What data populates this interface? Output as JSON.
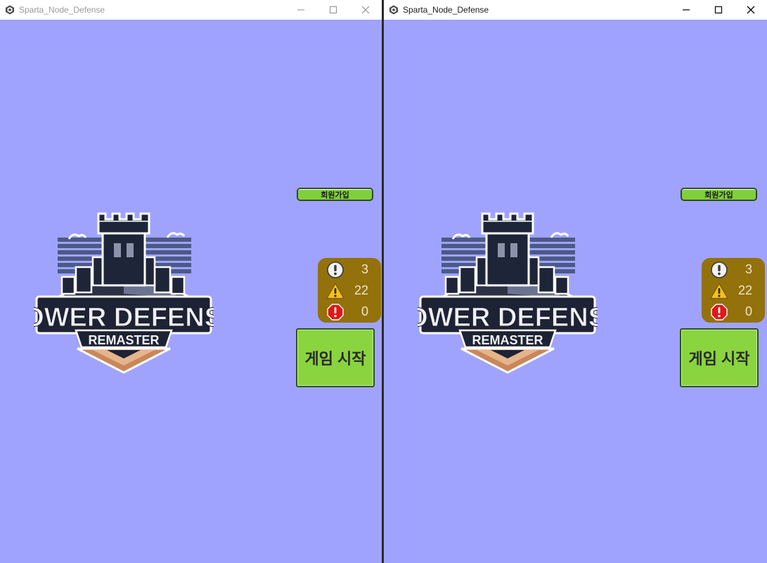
{
  "windows": [
    {
      "title": "Sparta_Node_Defense",
      "state": "inactive",
      "signup_label": "회원가입",
      "logo": {
        "line1": "TOWER DEFENSE",
        "line2": "REMASTER"
      },
      "stats": [
        {
          "icon": "info-icon",
          "value": "3"
        },
        {
          "icon": "warning-icon",
          "value": "22"
        },
        {
          "icon": "error-icon",
          "value": "0"
        }
      ],
      "start_label": "게임 시작"
    },
    {
      "title": "Sparta_Node_Defense",
      "state": "active",
      "signup_label": "회원가입",
      "logo": {
        "line1": "TOWER DEFENSE",
        "line2": "REMASTER"
      },
      "stats": [
        {
          "icon": "info-icon",
          "value": "3"
        },
        {
          "icon": "warning-icon",
          "value": "22"
        },
        {
          "icon": "error-icon",
          "value": "0"
        }
      ],
      "start_label": "게임 시작"
    }
  ],
  "colors": {
    "background": "#a0a3fd",
    "button_green": "#8ad43f",
    "stats_panel": "#93710b"
  }
}
